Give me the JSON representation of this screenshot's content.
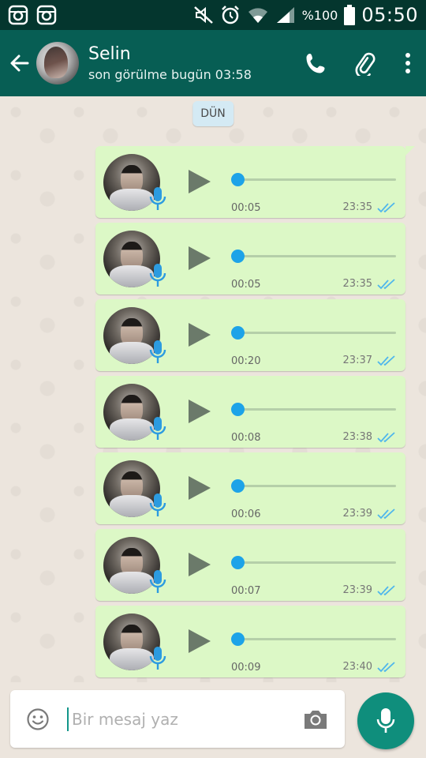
{
  "status_bar": {
    "battery_percent": "%100",
    "time": "05:50",
    "icons": [
      "instagram-icon",
      "instagram-icon",
      "mute-icon",
      "alarm-icon",
      "wifi-icon",
      "signal-icon",
      "battery-icon"
    ]
  },
  "header": {
    "contact_name": "Selin",
    "last_seen": "son görülme bugün 03:58",
    "icons": [
      "back-arrow-icon",
      "phone-icon",
      "paperclip-icon",
      "more-vert-icon"
    ]
  },
  "chat": {
    "date_chip": "DÜN",
    "messages": [
      {
        "duration": "00:05",
        "time": "23:35"
      },
      {
        "duration": "00:05",
        "time": "23:35"
      },
      {
        "duration": "00:20",
        "time": "23:37"
      },
      {
        "duration": "00:08",
        "time": "23:38"
      },
      {
        "duration": "00:06",
        "time": "23:39"
      },
      {
        "duration": "00:07",
        "time": "23:39"
      },
      {
        "duration": "00:09",
        "time": "23:40"
      }
    ]
  },
  "input": {
    "placeholder": "Bir mesaj yaz",
    "value": ""
  },
  "colors": {
    "header": "#075e54",
    "status_bar": "#04362e",
    "bubble": "#dcf8c6",
    "accent_blue": "#1da3e8",
    "fab": "#0f8e7c"
  }
}
